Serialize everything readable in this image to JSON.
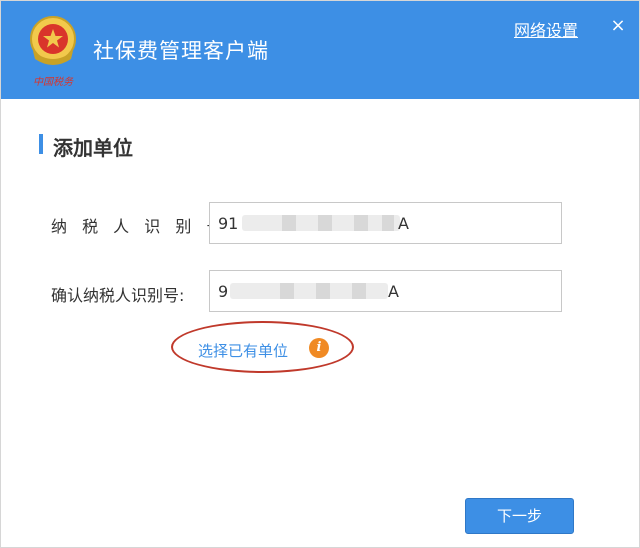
{
  "app": {
    "title": "社保费管理客户端",
    "logo_text": "中国税务"
  },
  "titlebar": {
    "network_settings": "网络设置",
    "close_glyph": "×"
  },
  "section": {
    "title": "添加单位"
  },
  "form": {
    "taxpayer_id_label": "纳 税 人 识 别 号:",
    "taxpayer_id_visible_prefix": "91",
    "taxpayer_id_visible_suffix": "A",
    "confirm_id_label": "确认纳税人识别号:",
    "confirm_id_visible_prefix": "9",
    "confirm_id_visible_suffix": "A"
  },
  "actions": {
    "select_existing": "选择已有单位",
    "info_glyph": "i",
    "next": "下一步"
  },
  "colors": {
    "primary": "#3d8fe5",
    "info_orange": "#f08a24",
    "highlight_ellipse": "#c0392b"
  }
}
